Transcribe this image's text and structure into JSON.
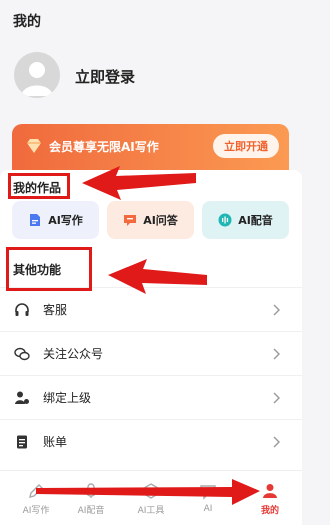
{
  "header": {
    "title": "我的"
  },
  "profile": {
    "login_label": "立即登录"
  },
  "vip": {
    "text": "会员尊享无限AI写作",
    "button": "立即开通"
  },
  "works": {
    "title": "我的作品",
    "items": [
      {
        "label": "AI写作",
        "icon": "doc-icon",
        "color": "#4c79f0"
      },
      {
        "label": "AI问答",
        "icon": "chat-icon",
        "color": "#f26a3d"
      },
      {
        "label": "AI配音",
        "icon": "audio-icon",
        "color": "#1fb6b4"
      }
    ]
  },
  "other": {
    "title": "其他功能",
    "items": [
      {
        "label": "客服",
        "icon": "headset-icon"
      },
      {
        "label": "关注公众号",
        "icon": "wechat-icon"
      },
      {
        "label": "绑定上级",
        "icon": "user-link-icon"
      },
      {
        "label": "账单",
        "icon": "bill-icon"
      }
    ]
  },
  "tabbar": {
    "items": [
      {
        "label": "AI写作",
        "icon": "pen-icon"
      },
      {
        "label": "AI配音",
        "icon": "mic-icon"
      },
      {
        "label": "AI工具",
        "icon": "tool-icon"
      },
      {
        "label": "AI",
        "icon": "chat-tab-icon"
      },
      {
        "label": "我的",
        "icon": "profile-icon"
      }
    ],
    "active_index": 4
  },
  "colors": {
    "accent": "#e53935",
    "vip_start": "#f06a3d",
    "vip_end": "#fb9a52"
  }
}
